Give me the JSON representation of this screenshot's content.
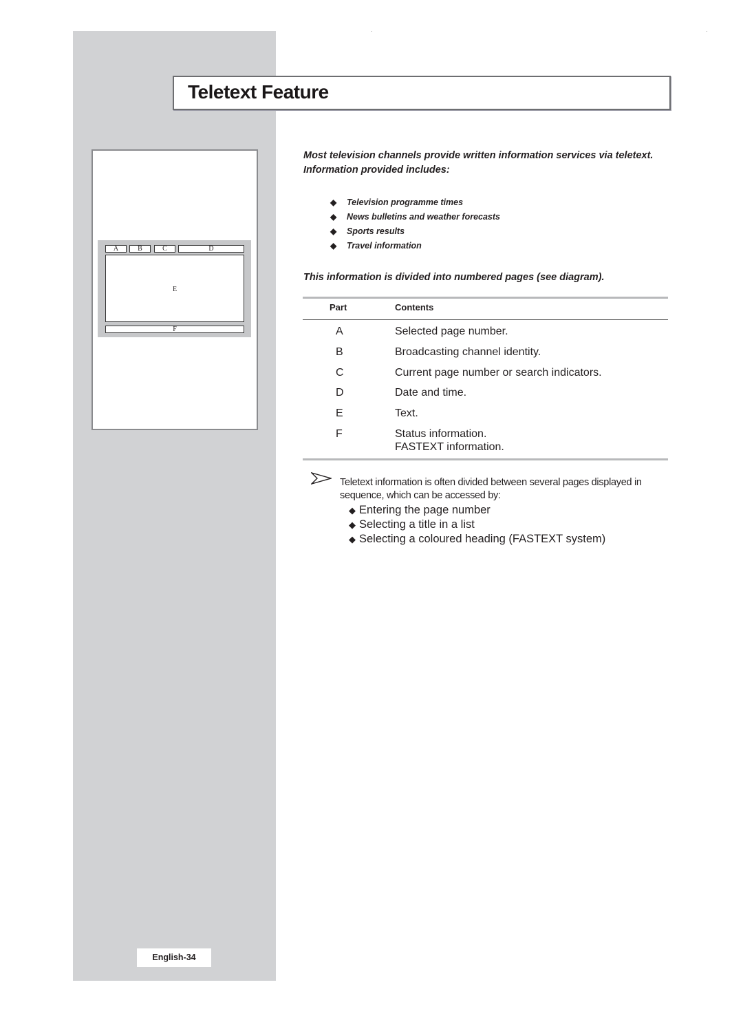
{
  "page": {
    "title": "Teletext Feature",
    "footer_label": "English-34"
  },
  "diagram": {
    "labels": {
      "a": "A",
      "b": "B",
      "c": "C",
      "d": "D",
      "e": "E",
      "f": "F"
    }
  },
  "intro": {
    "line1": "Most television channels provide written information services via teletext.",
    "line2": "Information provided includes:",
    "items": [
      "Television programme times",
      "News bulletins and weather forecasts",
      "Sports results",
      "Travel information"
    ],
    "divided": "This information is divided into numbered pages (see diagram)."
  },
  "table": {
    "headers": {
      "part": "Part",
      "contents": "Contents"
    },
    "rows": [
      {
        "part": "A",
        "content": "Selected page number."
      },
      {
        "part": "B",
        "content": "Broadcasting channel identity."
      },
      {
        "part": "C",
        "content": "Current page number or search indicators."
      },
      {
        "part": "D",
        "content": "Date and time."
      },
      {
        "part": "E",
        "content": "Text."
      },
      {
        "part": "F",
        "content": "Status information.",
        "content2": "FASTEXT information."
      }
    ]
  },
  "note": {
    "icon": "arrow-right-icon",
    "text": "Teletext information is often divided between several pages displayed in sequence, which can be accessed by:",
    "items": [
      "Entering the page number",
      "Selecting a title in a list",
      "Selecting a coloured heading (FASTEXT system)"
    ]
  },
  "glyphs": {
    "diamond": "◆"
  }
}
